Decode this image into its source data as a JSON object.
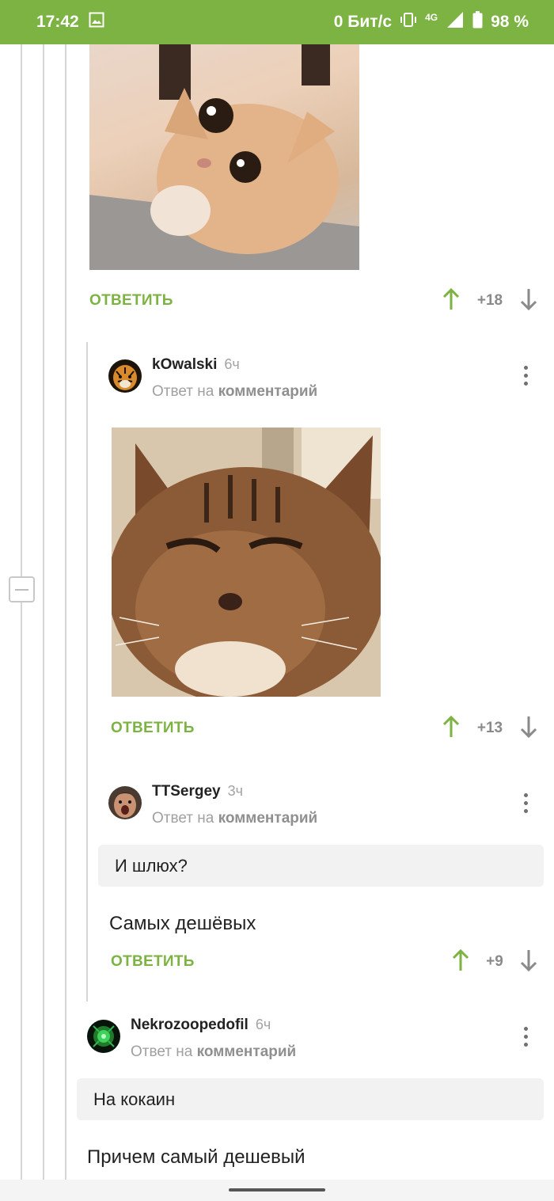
{
  "status_bar": {
    "time": "17:42",
    "network_speed": "0 Бит/с",
    "network_type": "4G",
    "battery": "98 %"
  },
  "labels": {
    "reply": "ОТВЕТИТЬ",
    "reply_to_prefix": "Ответ на",
    "reply_to_target": "комментарий"
  },
  "comments": [
    {
      "score": "+18"
    },
    {
      "username": "kOwalski",
      "time": "6ч",
      "score": "+13"
    },
    {
      "username": "TTSergey",
      "time": "3ч",
      "quote": "И шлюх?",
      "text": "Самых дешёвых",
      "score": "+9"
    },
    {
      "username": "Nekrozoopedofil",
      "time": "6ч",
      "quote": "На кокаин",
      "text": "Причем самый дешевый"
    }
  ],
  "colors": {
    "accent": "#7cb342",
    "vote_up": "#7cb342",
    "vote_down": "#8a8a8a"
  }
}
